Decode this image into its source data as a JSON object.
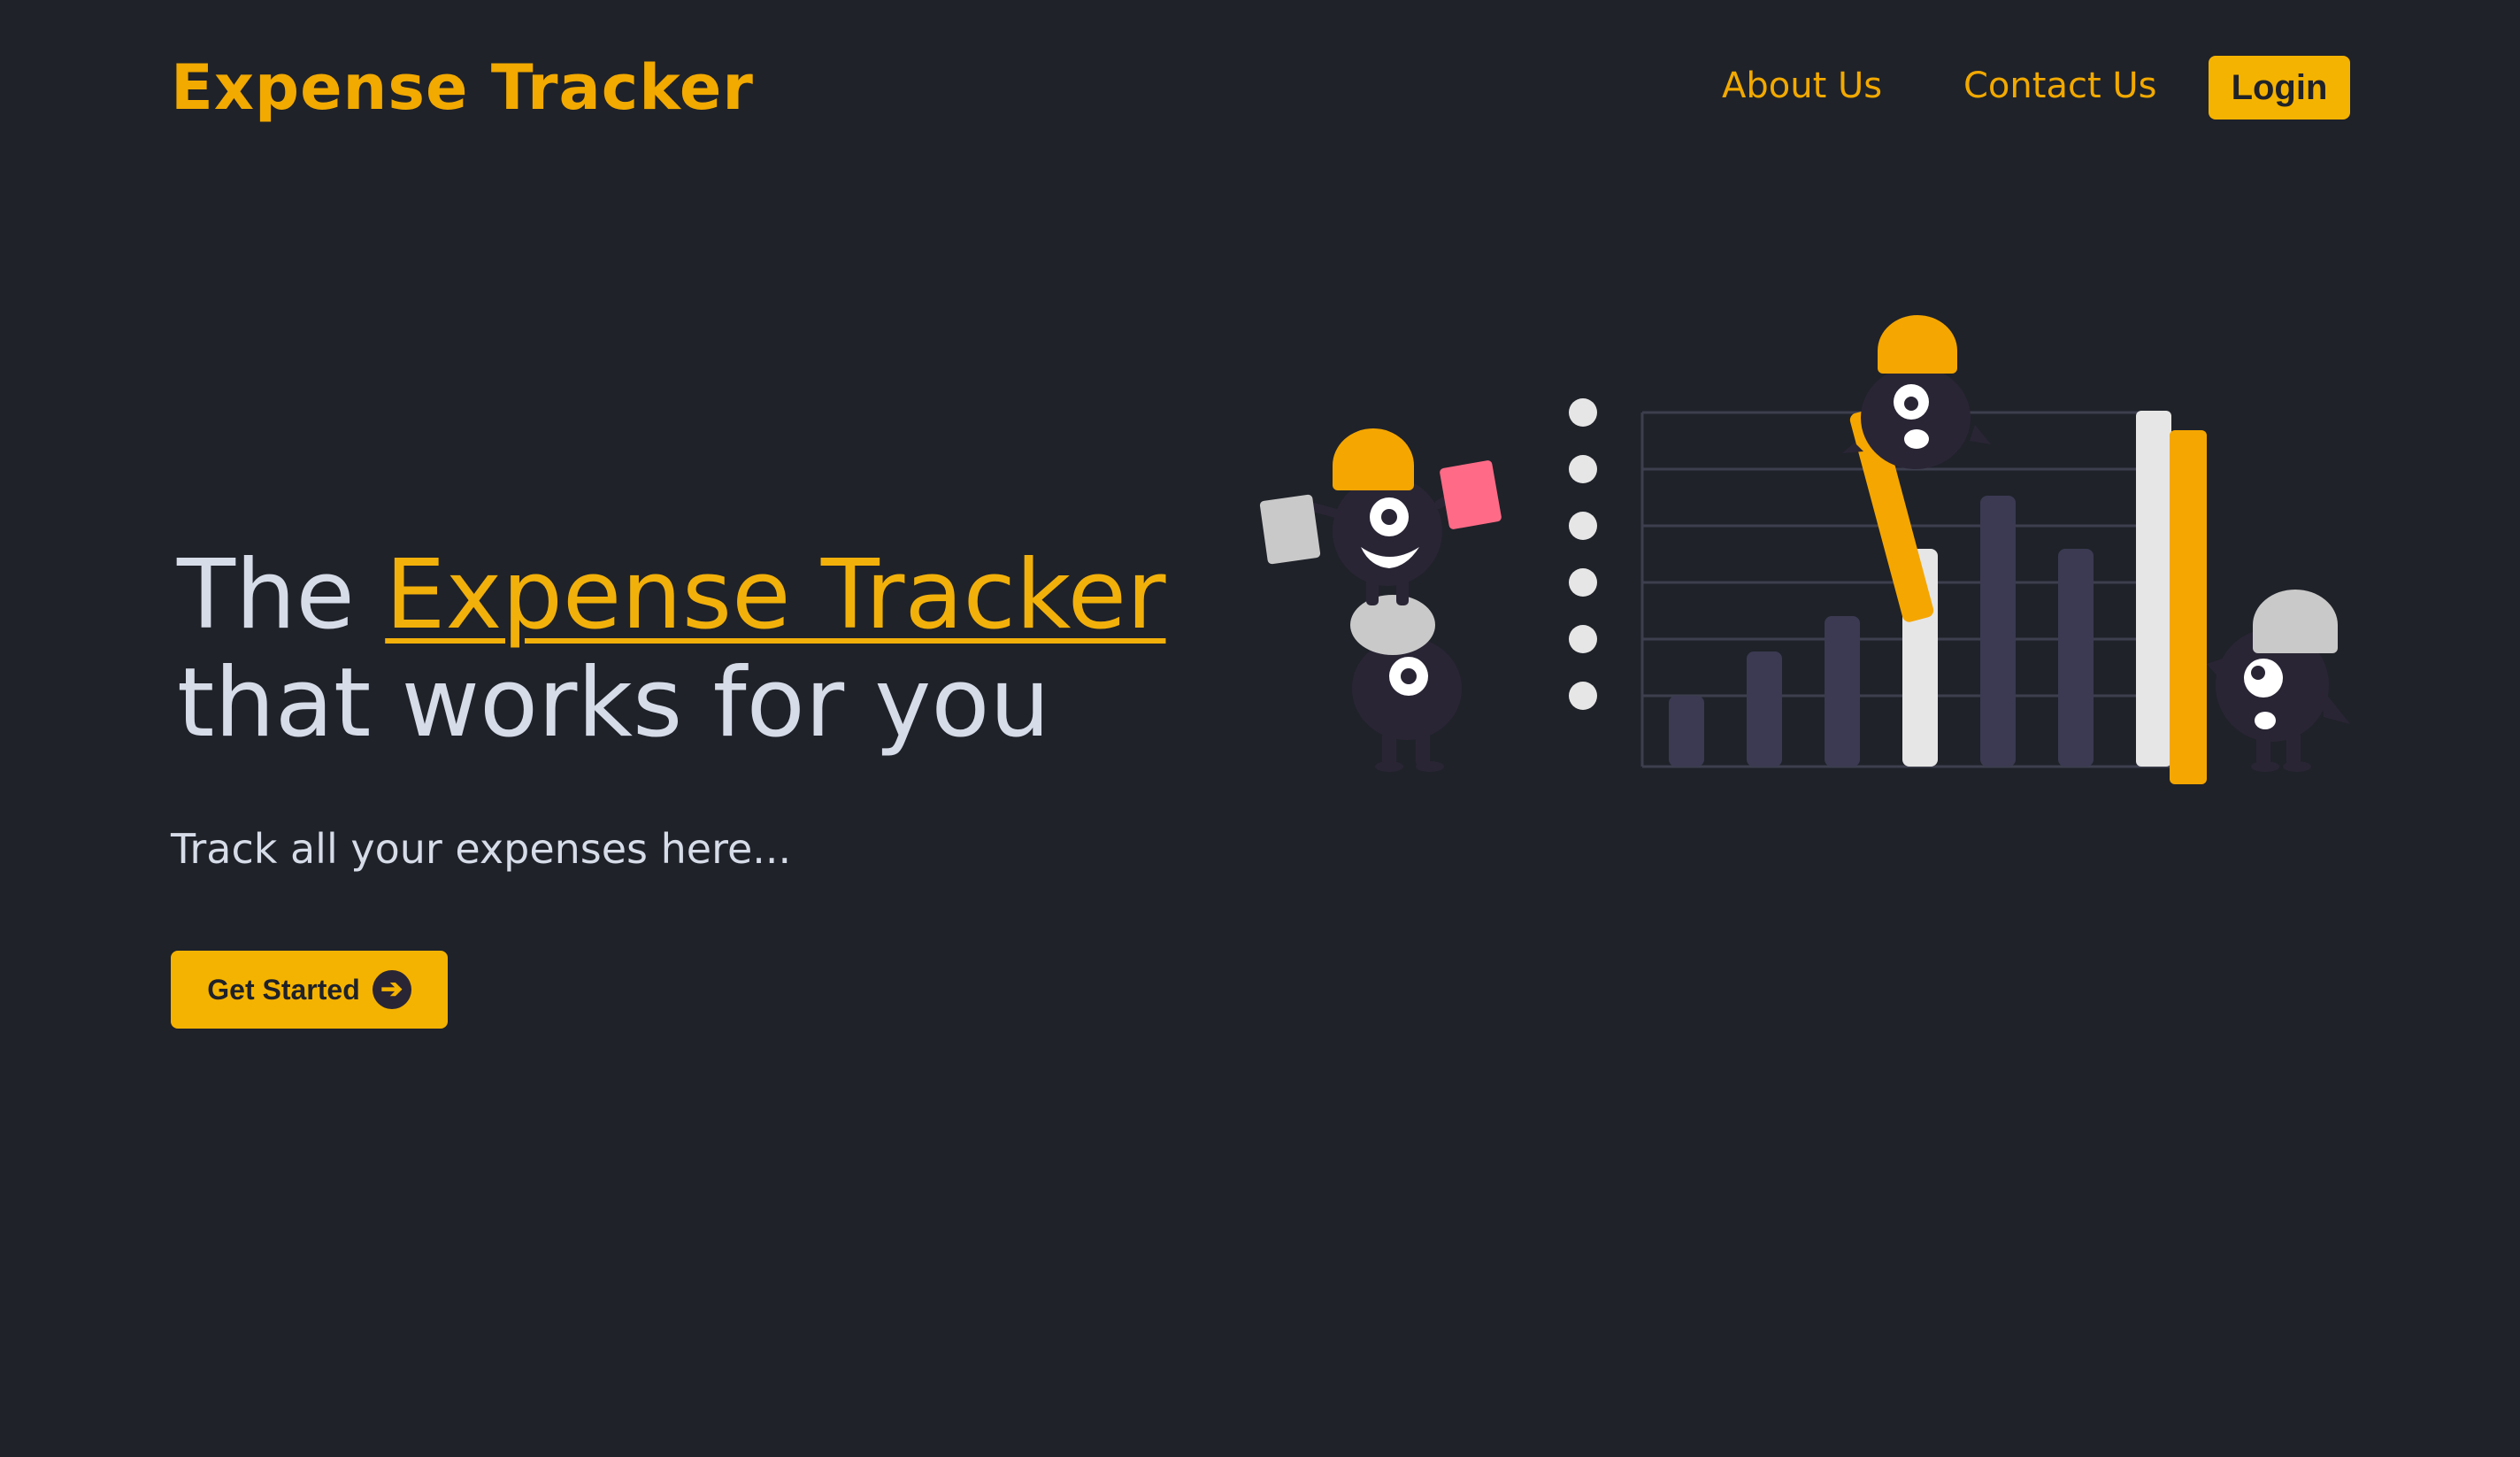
{
  "navbar": {
    "brand": "Expense Tracker",
    "links": [
      {
        "label": "About Us"
      },
      {
        "label": "Contact Us"
      }
    ],
    "login_label": "Login"
  },
  "hero": {
    "title_prefix": "The",
    "title_highlight": "Expense Tracker",
    "title_line2": "that works for you",
    "subtitle": "Track all your expenses here...",
    "cta_label": "Get Started",
    "cta_icon": "arrow-right-circle-icon"
  },
  "colors": {
    "background": "#1f2229",
    "accent": "#f5b301",
    "text": "#d6dce8",
    "character": "#2a2535",
    "bar": "#3b3a52"
  }
}
